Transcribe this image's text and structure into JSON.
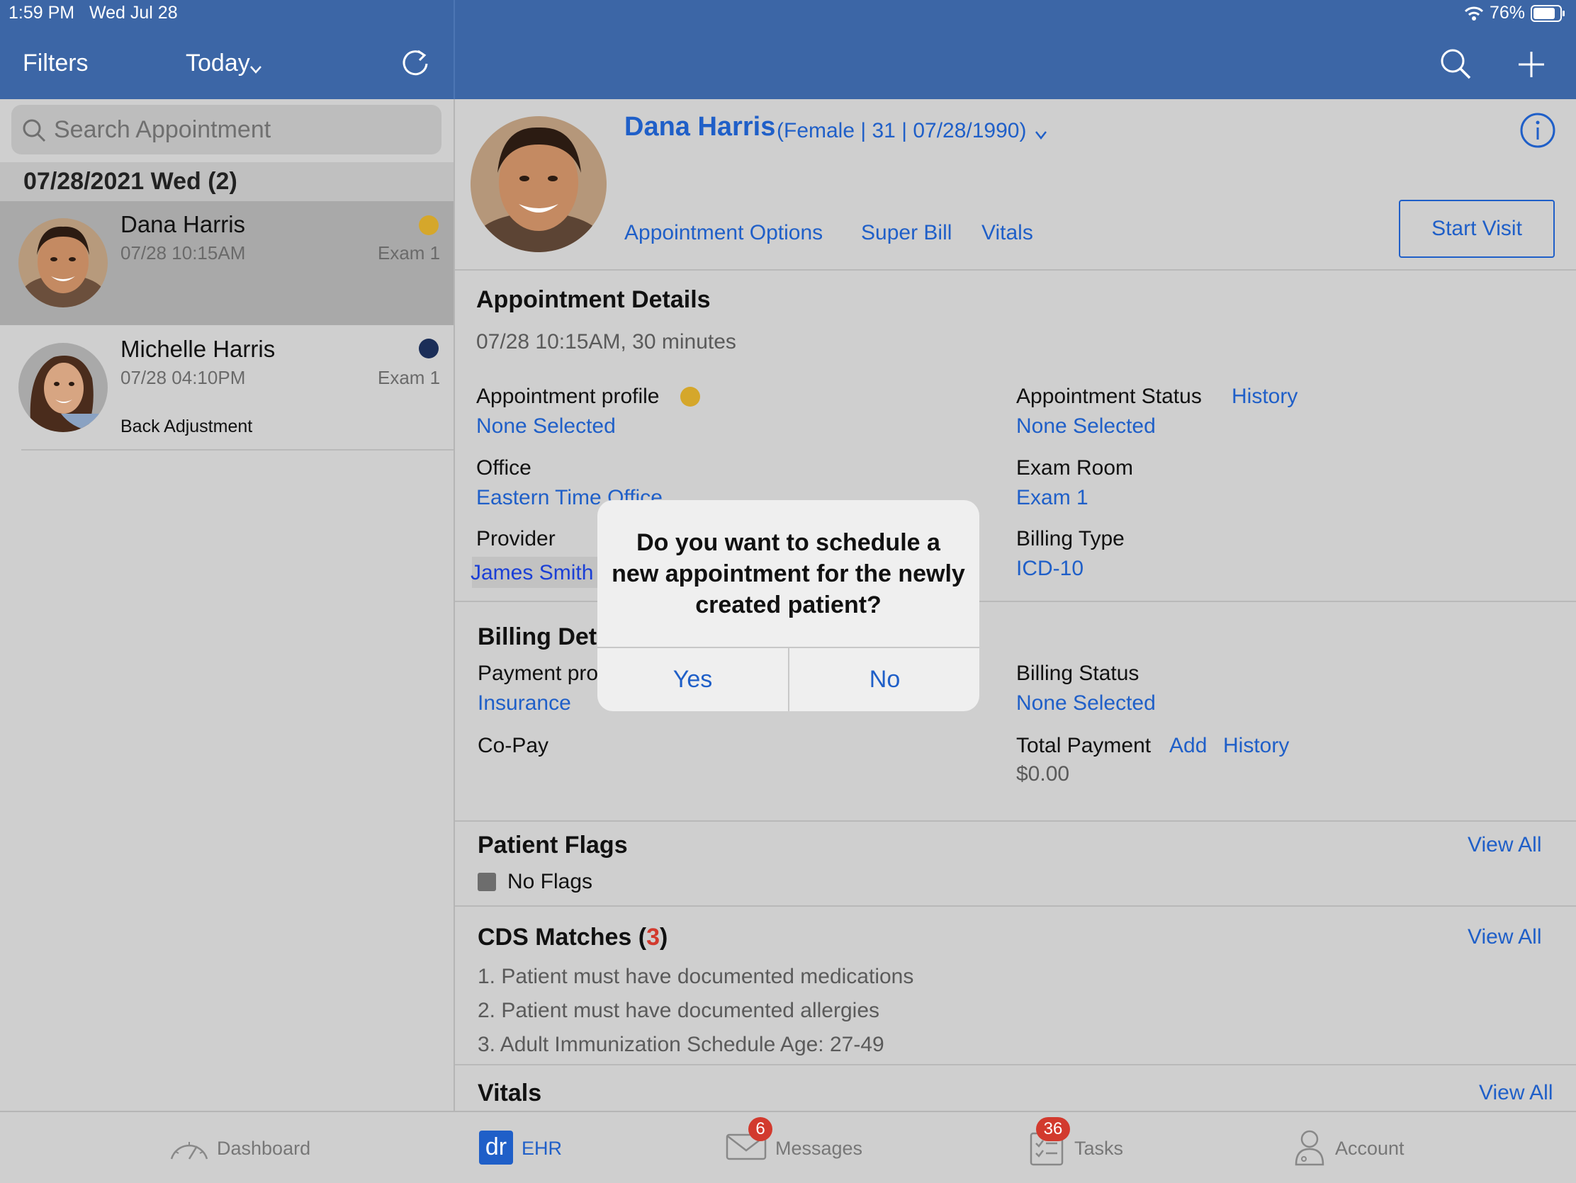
{
  "status_bar": {
    "time": "1:59 PM",
    "date": "Wed Jul 28",
    "battery": "76%"
  },
  "left_header": {
    "filters": "Filters",
    "today": "Today"
  },
  "search": {
    "placeholder": "Search Appointment"
  },
  "date_group": "07/28/2021 Wed (2)",
  "appointments": [
    {
      "name": "Dana Harris",
      "time": "07/28 10:15AM",
      "room": "Exam 1",
      "note": "",
      "dot_color": "#d5a72b"
    },
    {
      "name": "Michelle Harris",
      "time": "07/28 04:10PM",
      "room": "Exam 1",
      "note": "Back Adjustment",
      "dot_color": "#1b2e58"
    }
  ],
  "patient": {
    "name": "Dana Harris",
    "info": "(Female | 31 | 07/28/1990)",
    "links": [
      "Appointment Options",
      "Super Bill",
      "Vitals"
    ],
    "start_visit": "Start Visit"
  },
  "appointment_details": {
    "title": "Appointment Details",
    "time": "07/28 10:15AM, 30 minutes",
    "profile_label": "Appointment profile",
    "profile_value": "None Selected",
    "status_label": "Appointment Status",
    "status_history": "History",
    "status_value": "None Selected",
    "office_label": "Office",
    "office_value": "Eastern Time Office",
    "exam_room_label": "Exam Room",
    "exam_room_value": "Exam 1",
    "provider_label": "Provider",
    "provider_value": "James Smith",
    "billing_type_label": "Billing Type",
    "billing_type_value": "ICD-10"
  },
  "billing_details": {
    "title": "Billing Details",
    "payment_label": "Payment profile",
    "payment_value": "Insurance",
    "billing_status_label": "Billing Status",
    "billing_status_value": "None Selected",
    "copay_label": "Co-Pay",
    "total_label": "Total Payment",
    "total_add": "Add",
    "total_history": "History",
    "total_value": "$0.00"
  },
  "patient_flags": {
    "title": "Patient Flags",
    "view_all": "View All",
    "value": "No Flags"
  },
  "cds": {
    "title_prefix": "CDS Matches (",
    "count": "3",
    "title_suffix": ")",
    "view_all": "View All",
    "items": [
      "1. Patient must have documented medications",
      "2. Patient must have documented allergies",
      "3. Adult Immunization Schedule Age: 27-49"
    ]
  },
  "vitals": {
    "title": "Vitals",
    "view_all": "View All"
  },
  "modal": {
    "message": "Do you want to schedule a new appointment for the newly created patient?",
    "yes": "Yes",
    "no": "No"
  },
  "tabbar": {
    "dashboard": "Dashboard",
    "ehr": "EHR",
    "ehr_logo": "dr",
    "messages": "Messages",
    "messages_badge": "6",
    "tasks": "Tasks",
    "tasks_badge": "36",
    "account": "Account"
  },
  "colors": {
    "header": "#3c66a6",
    "link": "#1f5fc8",
    "badge": "#d23a2e"
  }
}
